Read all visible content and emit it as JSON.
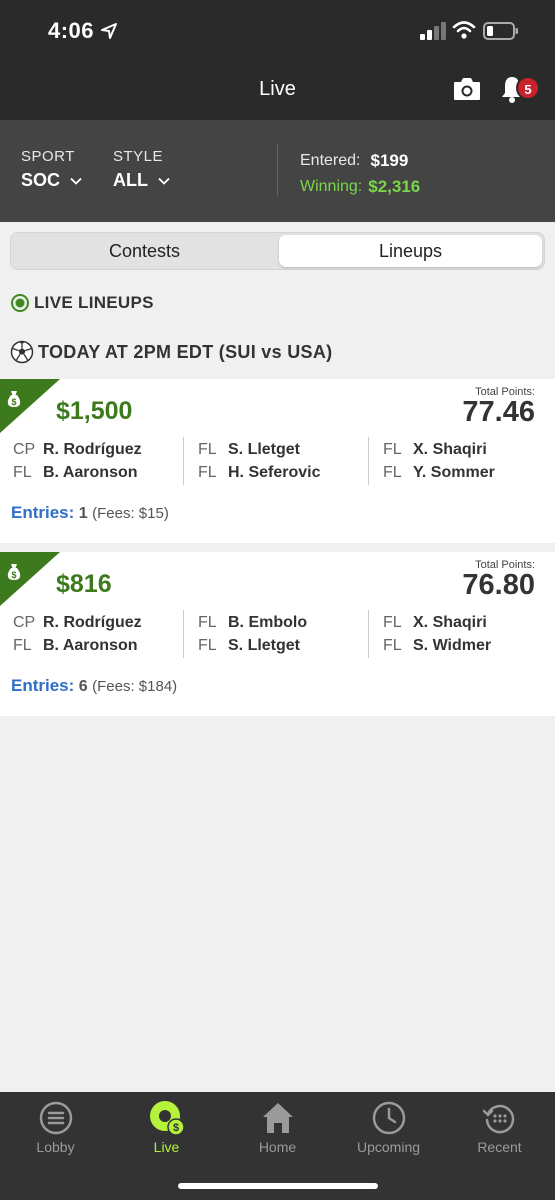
{
  "status_bar": {
    "time": "4:06"
  },
  "header": {
    "title": "Live",
    "notification_count": "5"
  },
  "filters": {
    "sport": {
      "label": "SPORT",
      "value": "SOC"
    },
    "style": {
      "label": "STYLE",
      "value": "ALL"
    },
    "entered_label": "Entered:",
    "entered_value": "$199",
    "winning_label": "Winning:",
    "winning_value": "$2,316"
  },
  "tabs_segment": {
    "contests": "Contests",
    "lineups": "Lineups",
    "selected": "Lineups"
  },
  "section": {
    "live_lineups": "LIVE LINEUPS",
    "match": "TODAY AT 2PM EDT  (SUI vs USA)"
  },
  "lineups": [
    {
      "prize": "$1,500",
      "total_points_label": "Total Points:",
      "total_points": "77.46",
      "players": [
        {
          "pos": "CP",
          "name": "R. Rodríguez"
        },
        {
          "pos": "FL",
          "name": "B. Aaronson"
        },
        {
          "pos": "FL",
          "name": "S. Lletget"
        },
        {
          "pos": "FL",
          "name": "H. Seferovic"
        },
        {
          "pos": "FL",
          "name": "X. Shaqiri"
        },
        {
          "pos": "FL",
          "name": "Y. Sommer"
        }
      ],
      "entries_label": "Entries:",
      "entries_count": "1",
      "fees": "(Fees: $15)"
    },
    {
      "prize": "$816",
      "total_points_label": "Total Points:",
      "total_points": "76.80",
      "players": [
        {
          "pos": "CP",
          "name": "R. Rodríguez"
        },
        {
          "pos": "FL",
          "name": "B. Aaronson"
        },
        {
          "pos": "FL",
          "name": "B. Embolo"
        },
        {
          "pos": "FL",
          "name": "S. Lletget"
        },
        {
          "pos": "FL",
          "name": "X. Shaqiri"
        },
        {
          "pos": "FL",
          "name": "S. Widmer"
        }
      ],
      "entries_label": "Entries:",
      "entries_count": "6",
      "fees": "(Fees: $184)"
    }
  ],
  "tabbar": {
    "items": [
      {
        "label": "Lobby",
        "icon": "lobby-icon"
      },
      {
        "label": "Live",
        "icon": "live-icon",
        "active": true
      },
      {
        "label": "Home",
        "icon": "home-icon"
      },
      {
        "label": "Upcoming",
        "icon": "clock-icon"
      },
      {
        "label": "Recent",
        "icon": "history-icon"
      }
    ]
  },
  "colors": {
    "header_bg": "#2a2a2a",
    "filter_bg": "#444444",
    "prize_green": "#3d7a1e",
    "winning_green": "#7bd54a",
    "entries_blue": "#2f6fc6",
    "active_tab": "#b5f23a",
    "badge_red": "#c8232c"
  }
}
